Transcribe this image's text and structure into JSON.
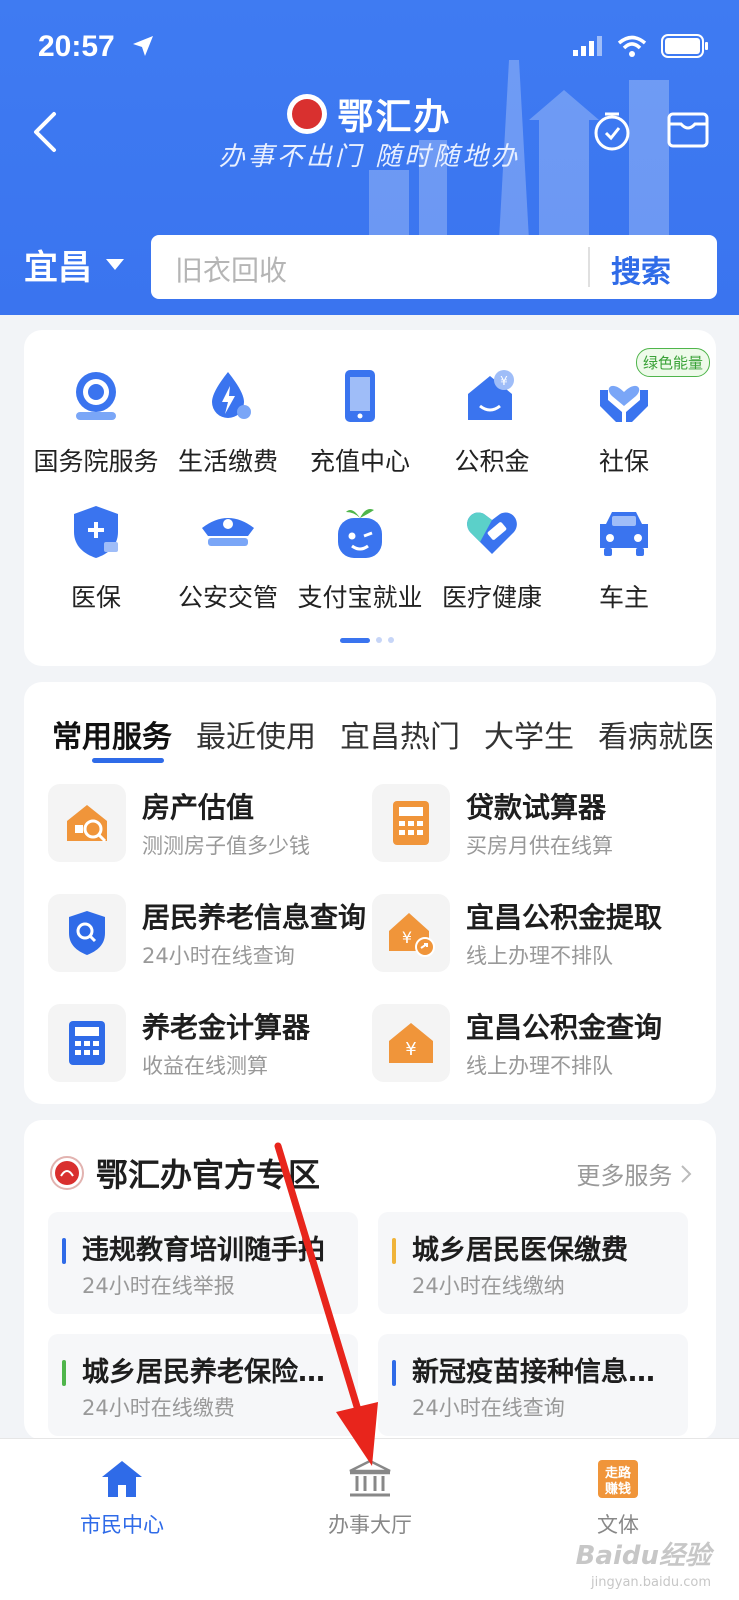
{
  "status": {
    "time": "20:57"
  },
  "header": {
    "app_name": "鄂汇办",
    "slogan": "办事不出门 随时随地办",
    "city": "宜昌",
    "search_placeholder": "旧衣回收",
    "search_button": "搜索"
  },
  "quick_grid": {
    "badge": "绿色能量",
    "items": [
      {
        "label": "国务院服务",
        "icon": "state-council-icon"
      },
      {
        "label": "生活缴费",
        "icon": "utility-payment-icon"
      },
      {
        "label": "充值中心",
        "icon": "recharge-phone-icon"
      },
      {
        "label": "公积金",
        "icon": "housing-fund-icon"
      },
      {
        "label": "社保",
        "icon": "social-security-icon"
      },
      {
        "label": "医保",
        "icon": "medical-insurance-icon"
      },
      {
        "label": "公安交管",
        "icon": "police-traffic-icon"
      },
      {
        "label": "支付宝就业",
        "icon": "alipay-employment-icon"
      },
      {
        "label": "医疗健康",
        "icon": "health-icon"
      },
      {
        "label": "车主",
        "icon": "car-owner-icon"
      }
    ]
  },
  "services": {
    "tabs": [
      "常用服务",
      "最近使用",
      "宜昌热门",
      "大学生",
      "看病就医"
    ],
    "active_tab": 0,
    "items": [
      {
        "title": "房产估值",
        "subtitle": "测测房子值多少钱",
        "icon": "house-value-icon",
        "color": "#f0953a"
      },
      {
        "title": "贷款试算器",
        "subtitle": "买房月供在线算",
        "icon": "loan-calculator-icon",
        "color": "#f0953a"
      },
      {
        "title": "居民养老信息查询",
        "subtitle": "24小时在线查询",
        "icon": "pension-search-icon",
        "color": "#2f6be8"
      },
      {
        "title": "宜昌公积金提取",
        "subtitle": "线上办理不排队",
        "icon": "fund-withdraw-icon",
        "color": "#f0953a"
      },
      {
        "title": "养老金计算器",
        "subtitle": "收益在线测算",
        "icon": "pension-calculator-icon",
        "color": "#2f6be8"
      },
      {
        "title": "宜昌公积金查询",
        "subtitle": "线上办理不排队",
        "icon": "fund-query-icon",
        "color": "#f0953a"
      }
    ]
  },
  "zone": {
    "title": "鄂汇办官方专区",
    "more": "更多服务",
    "items": [
      {
        "title": "违规教育培训随手拍",
        "subtitle": "24小时在线举报",
        "color": "#2f6be8"
      },
      {
        "title": "城乡居民医保缴费",
        "subtitle": "24小时在线缴纳",
        "color": "#f0b43a"
      },
      {
        "title": "城乡居民养老保险缴费",
        "subtitle": "24小时在线缴费",
        "color": "#4fb54b"
      },
      {
        "title": "新冠疫苗接种信息查询",
        "subtitle": "24小时在线查询",
        "color": "#2f6be8"
      }
    ]
  },
  "bottom_nav": {
    "items": [
      {
        "label": "市民中心",
        "icon": "home-icon"
      },
      {
        "label": "办事大厅",
        "icon": "government-hall-icon"
      },
      {
        "label": "文体",
        "icon": "culture-sports-icon"
      }
    ],
    "active": 0
  },
  "watermark": {
    "text": "Baidu经验",
    "url": "jingyan.baidu.com"
  },
  "colors": {
    "brand_blue": "#3a74ef",
    "accent_orange": "#f0953a",
    "arrow_red": "#e8251c"
  }
}
